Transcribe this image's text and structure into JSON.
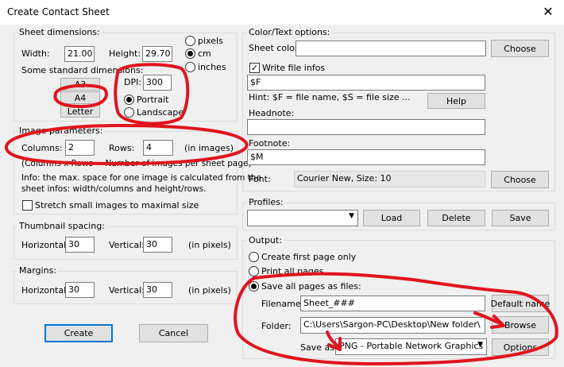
{
  "window": {
    "title": "Create Contact Sheet",
    "close_glyph": "✕"
  },
  "sheet_dimensions": {
    "label": "Sheet dimensions:",
    "width_label": "Width:",
    "width_value": "21.00",
    "height_label": "Height:",
    "height_value": "29.70",
    "units": [
      {
        "label": "pixels",
        "selected": false
      },
      {
        "label": "cm",
        "selected": true
      },
      {
        "label": "inches",
        "selected": false
      }
    ],
    "standard_label": "Some standard dimensions:",
    "standard_buttons": [
      "A3",
      "A4",
      "Letter"
    ],
    "dpi_label": "DPI:",
    "dpi_value": "300",
    "orientation": [
      {
        "label": "Portrait",
        "selected": true
      },
      {
        "label": "Landscape",
        "selected": false
      }
    ]
  },
  "image_parameters": {
    "label": "Image parameters:",
    "columns_label": "Columns:",
    "columns_value": "2",
    "rows_label": "Rows:",
    "rows_value": "4",
    "rows_unit": "(in images)",
    "product_note": "(Columns x Rows = Number of images per sheet page)",
    "info_line1": "Info: the max. space for one image is calculated from the",
    "info_line2": "sheet infos: width/columns and height/rows.",
    "stretch_label": "Stretch small images to maximal size"
  },
  "thumbnail_spacing": {
    "label": "Thumbnail spacing:",
    "horizontal_label": "Horizontal:",
    "horizontal_value": "30",
    "vertical_label": "Vertical:",
    "vertical_value": "30",
    "unit": "(in pixels)"
  },
  "margins": {
    "label": "Margins:",
    "horizontal_label": "Horizontal:",
    "horizontal_value": "30",
    "vertical_label": "Vertical:",
    "vertical_value": "30",
    "unit": "(in pixels)"
  },
  "footer": {
    "create_label": "Create",
    "cancel_label": "Cancel"
  },
  "color_text": {
    "label": "Color/Text options:",
    "sheet_color_label": "Sheet color:",
    "sheet_color_value": "",
    "choose_label": "Choose",
    "write_file_infos_label": "Write file infos",
    "write_file_infos_checked": true,
    "file_info_value": "$F",
    "hint": "Hint: $F = file name, $S = file size ...",
    "help_label": "Help",
    "headnote_label": "Headnote:",
    "headnote_value": "",
    "footnote_label": "Footnote:",
    "footnote_value": "$M",
    "font_label": "Font:",
    "font_value": "Courier New, Size: 10",
    "font_choose_label": "Choose"
  },
  "profiles": {
    "label": "Profiles:",
    "selected": "",
    "load_label": "Load",
    "delete_label": "Delete",
    "save_label": "Save"
  },
  "output": {
    "label": "Output:",
    "options": [
      {
        "label": "Create first page only",
        "selected": false
      },
      {
        "label": "Print all pages",
        "selected": false
      },
      {
        "label": "Save all pages as files:",
        "selected": true
      }
    ],
    "filename_label": "Filename:",
    "filename_value": "Sheet_###",
    "default_name_label": "Default name",
    "folder_label": "Folder:",
    "folder_value": "C:\\Users\\Sargon-PC\\Desktop\\New folder\\",
    "browse_label": "Browse",
    "save_as_label": "Save as:",
    "save_as_value": "PNG - Portable Network Graphics",
    "options_label": "Options"
  },
  "annotation_color": "#e0141e"
}
